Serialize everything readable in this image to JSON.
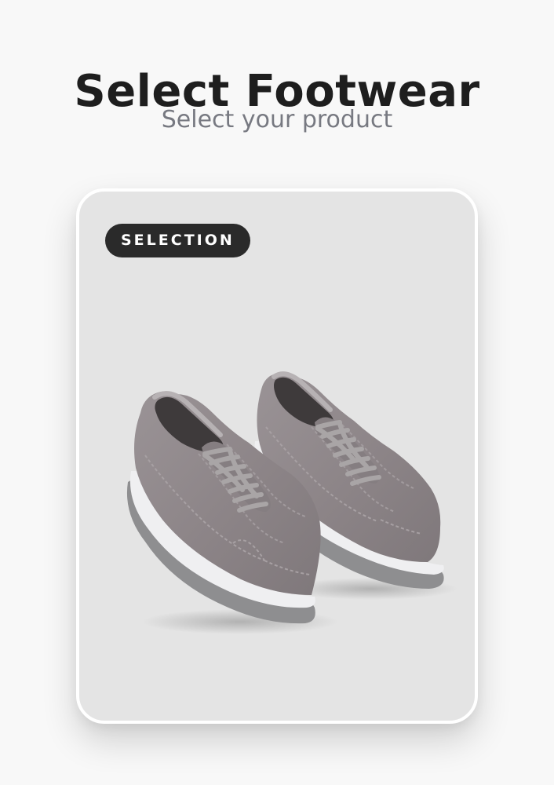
{
  "header": {
    "title": "Select Footwear",
    "subtitle": "Select your product"
  },
  "product_card": {
    "badge_label": "SELECTION",
    "image_icon": "grey-suede-sneakers-image",
    "colors": {
      "suede": "#8f878a",
      "sole": "#efeff1",
      "outsole": "#8e8e90",
      "laces": "#a9a5a6"
    }
  }
}
